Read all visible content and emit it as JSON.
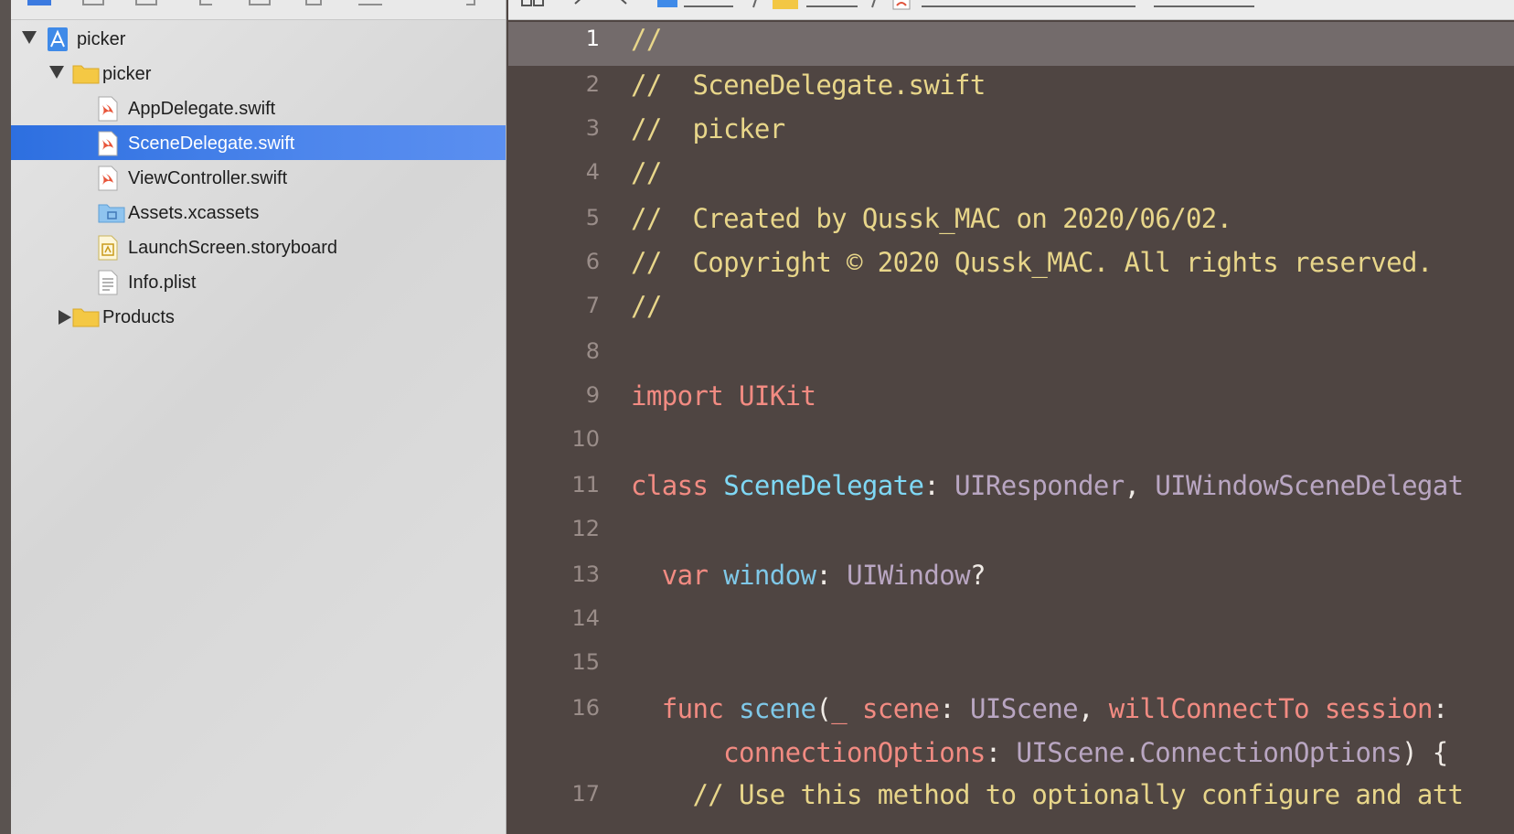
{
  "colors": {
    "editor_background": "#4f4542",
    "current_line_highlight": "#736b6b",
    "selection_blue": "#2d6fe0",
    "comment": "#e8d68a",
    "keyword": "#f28b82",
    "class_name": "#7fd8f5",
    "property": "#7fc8e8",
    "type": "#b9a6c2",
    "plain": "#f0ebe6",
    "line_number": "#9a8d89"
  },
  "navigator": {
    "items": [
      {
        "label": "picker",
        "icon": "xcode-project-icon",
        "disclosure": "open"
      },
      {
        "label": "picker",
        "icon": "folder-icon",
        "disclosure": "open"
      },
      {
        "label": "AppDelegate.swift",
        "icon": "swift-file-icon"
      },
      {
        "label": "SceneDelegate.swift",
        "icon": "swift-file-icon",
        "selected": true
      },
      {
        "label": "ViewController.swift",
        "icon": "swift-file-icon"
      },
      {
        "label": "Assets.xcassets",
        "icon": "asset-catalog-icon"
      },
      {
        "label": "LaunchScreen.storyboard",
        "icon": "storyboard-file-icon"
      },
      {
        "label": "Info.plist",
        "icon": "plist-file-icon"
      },
      {
        "label": "Products",
        "icon": "folder-icon",
        "disclosure": "closed"
      }
    ]
  },
  "editor": {
    "current_line": 1,
    "lines": [
      {
        "number": "1",
        "tokens": [
          {
            "text": "//",
            "kind": "comment"
          }
        ]
      },
      {
        "number": "2",
        "tokens": [
          {
            "text": "//  SceneDelegate.swift",
            "kind": "comment"
          }
        ]
      },
      {
        "number": "3",
        "tokens": [
          {
            "text": "//  picker",
            "kind": "comment"
          }
        ]
      },
      {
        "number": "4",
        "tokens": [
          {
            "text": "//",
            "kind": "comment"
          }
        ]
      },
      {
        "number": "5",
        "tokens": [
          {
            "text": "//  Created by Qussk_MAC on 2020/06/02.",
            "kind": "comment"
          }
        ]
      },
      {
        "number": "6",
        "tokens": [
          {
            "text": "//  Copyright © 2020 Qussk_MAC. All rights reserved.",
            "kind": "comment"
          }
        ]
      },
      {
        "number": "7",
        "tokens": [
          {
            "text": "//",
            "kind": "comment"
          }
        ]
      },
      {
        "number": "8",
        "tokens": []
      },
      {
        "number": "9",
        "tokens": [
          {
            "text": "import",
            "kind": "keyword"
          },
          {
            "text": " ",
            "kind": "plain"
          },
          {
            "text": "UIKit",
            "kind": "keyword"
          }
        ]
      },
      {
        "number": "10",
        "tokens": []
      },
      {
        "number": "11",
        "tokens": [
          {
            "text": "class",
            "kind": "keyword"
          },
          {
            "text": " ",
            "kind": "plain"
          },
          {
            "text": "SceneDelegate",
            "kind": "class"
          },
          {
            "text": ": ",
            "kind": "plain"
          },
          {
            "text": "UIResponder",
            "kind": "type"
          },
          {
            "text": ", ",
            "kind": "plain"
          },
          {
            "text": "UIWindowSceneDelegat",
            "kind": "type"
          }
        ]
      },
      {
        "number": "12",
        "tokens": []
      },
      {
        "number": "13",
        "tokens": [
          {
            "text": "  ",
            "kind": "plain"
          },
          {
            "text": "var",
            "kind": "keyword"
          },
          {
            "text": " ",
            "kind": "plain"
          },
          {
            "text": "window",
            "kind": "prop"
          },
          {
            "text": ": ",
            "kind": "plain"
          },
          {
            "text": "UIWindow",
            "kind": "type"
          },
          {
            "text": "?",
            "kind": "plain"
          }
        ]
      },
      {
        "number": "14",
        "tokens": []
      },
      {
        "number": "15",
        "tokens": []
      },
      {
        "number": "16",
        "tokens": [
          {
            "text": "  ",
            "kind": "plain"
          },
          {
            "text": "func",
            "kind": "keyword"
          },
          {
            "text": " ",
            "kind": "plain"
          },
          {
            "text": "scene",
            "kind": "prop"
          },
          {
            "text": "(",
            "kind": "plain"
          },
          {
            "text": "_ scene",
            "kind": "keyword"
          },
          {
            "text": ": ",
            "kind": "plain"
          },
          {
            "text": "UIScene",
            "kind": "type"
          },
          {
            "text": ", ",
            "kind": "plain"
          },
          {
            "text": "willConnectTo session",
            "kind": "keyword"
          },
          {
            "text": ":",
            "kind": "plain"
          }
        ]
      },
      {
        "number": "",
        "tokens": [
          {
            "text": "      ",
            "kind": "plain"
          },
          {
            "text": "connectionOptions",
            "kind": "keyword"
          },
          {
            "text": ": ",
            "kind": "plain"
          },
          {
            "text": "UIScene",
            "kind": "type"
          },
          {
            "text": ".",
            "kind": "plain"
          },
          {
            "text": "ConnectionOptions",
            "kind": "type"
          },
          {
            "text": ") {",
            "kind": "plain"
          }
        ]
      },
      {
        "number": "17",
        "tokens": [
          {
            "text": "    // Use this method to optionally configure and att",
            "kind": "comment"
          }
        ]
      }
    ]
  }
}
